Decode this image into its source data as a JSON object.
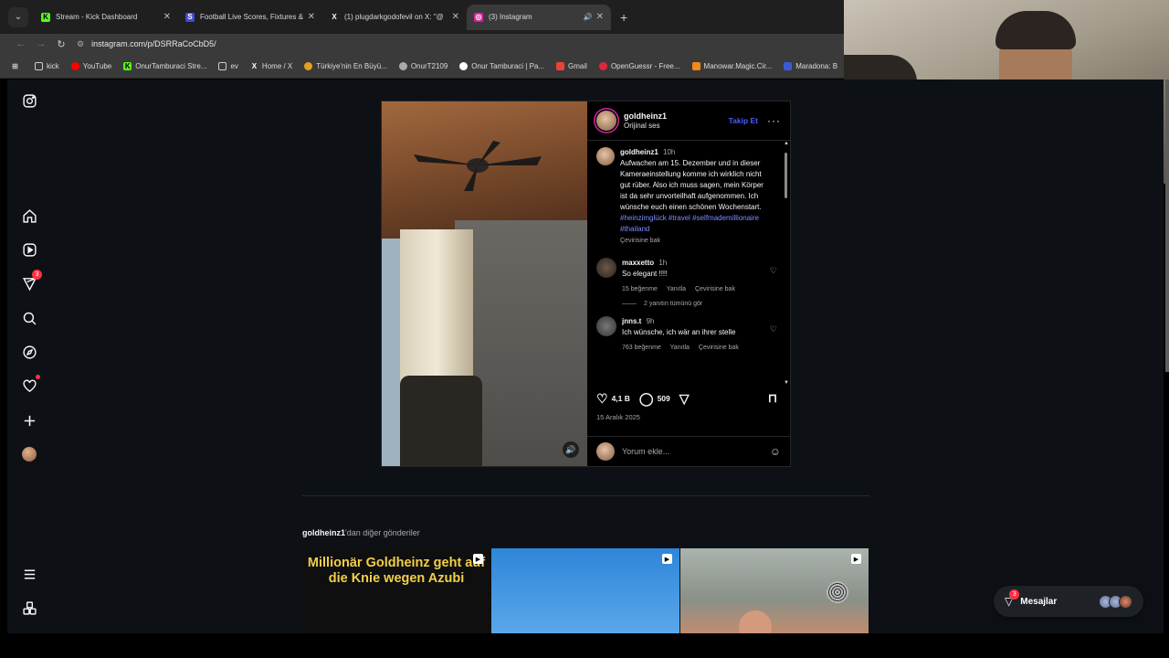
{
  "browser": {
    "tabs": [
      {
        "title": "Stream - Kick Dashboard",
        "fav_color": "#53fc18",
        "fav_glyph": "K",
        "active": false
      },
      {
        "title": "Football Live Scores, Fixtures &",
        "fav_color": "#3f4cd6",
        "fav_glyph": "S",
        "active": false
      },
      {
        "title": "(1) plugdarkgodofevil on X: \"@",
        "fav_color": "#ffffff",
        "fav_glyph": "X",
        "active": false
      },
      {
        "title": "(3) Instagram",
        "fav_color": "#d6249f",
        "fav_glyph": "◎",
        "active": true
      }
    ],
    "new_tab": "+",
    "url": "instagram.com/p/DSRRaCoCbD5/",
    "bookmarks": [
      {
        "label": "kick",
        "icon": "folder-icon"
      },
      {
        "label": "YouTube",
        "icon": "youtube-icon"
      },
      {
        "label": "OnurTamburaci Stre...",
        "icon": "kick-icon"
      },
      {
        "label": "ev",
        "icon": "folder-icon"
      },
      {
        "label": "Home / X",
        "icon": "x-icon"
      },
      {
        "label": "Türkiye'nin En Büyü...",
        "icon": "site-icon"
      },
      {
        "label": "OnurT2109",
        "icon": "site-icon"
      },
      {
        "label": "Onur Tamburaci | Pa...",
        "icon": "site-icon"
      },
      {
        "label": "Gmail",
        "icon": "gmail-icon"
      },
      {
        "label": "OpenGuessr - Free...",
        "icon": "site-icon"
      },
      {
        "label": "Manowar.Magic.Cir...",
        "icon": "site-icon"
      },
      {
        "label": "Maradona: B",
        "icon": "site-icon"
      }
    ]
  },
  "sidebar": {
    "notifications_badge": "3"
  },
  "post": {
    "username": "goldheinz1",
    "audio": "Orijinal ses",
    "follow_label": "Takip Et",
    "more": "···",
    "caption": {
      "username": "goldheinz1",
      "time": "10h",
      "text": "Aufwachen am 15. Dezember und in dieser Kameraeinstellung komme ich wirklich nicht gut rüber. Also ich muss sagen, mein Körper ist da sehr unvorteilhaft aufgenommen. Ich wünsche euch einen schönen Wochenstart.",
      "hashtags": "#heinzimglück #travel #selfmademillionaire #thailand",
      "translate": "Çevirisine bak"
    },
    "comments": [
      {
        "username": "maxxetto",
        "time": "1h",
        "text": "So elegant !!!!",
        "likes": "15 beğenme",
        "reply": "Yanıtla",
        "translate": "Çevirisine bak",
        "replies": "2 yanıtın tümünü gör"
      },
      {
        "username": "jnns.t",
        "time": "9h",
        "text": "Ich wünsche, ich wär an ihrer stelle",
        "likes": "763 beğenme",
        "reply": "Yanıtla",
        "translate": "Çevirisine bak"
      }
    ],
    "likes_count": "4,1 B",
    "comments_count": "509",
    "date": "15 Aralık 2025",
    "add_comment_placeholder": "Yorum ekle..."
  },
  "more_posts": {
    "username": "goldheinz1",
    "suffix": "'dan diğer gönderiler",
    "thumb1_caption": "Millionär Goldheinz geht auf die Knie wegen Azubi"
  },
  "messages": {
    "label": "Mesajlar",
    "badge": "3"
  }
}
